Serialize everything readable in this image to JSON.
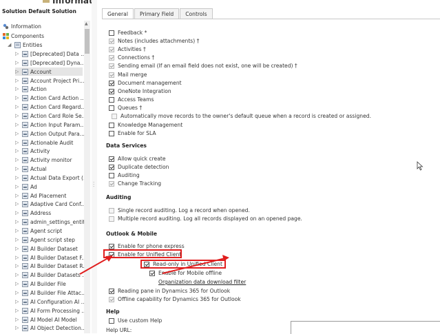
{
  "window": {
    "title": "Information"
  },
  "tree": {
    "solution": "Solution Default Solution",
    "top": [
      {
        "label": "Information",
        "icon": "info-icon"
      },
      {
        "label": "Components",
        "icon": "components-icon"
      },
      {
        "label": "Entities",
        "icon": "entities-icon"
      }
    ],
    "entities": [
      "[Deprecated] Data ...",
      "[Deprecated] Dyna...",
      "Account",
      "Account Project Pri...",
      "Action",
      "Action Card Action ...",
      "Action Card Regard...",
      "Action Card Role Se...",
      "Action Input Param...",
      "Action Output Para...",
      "Actionable Audit",
      "Activity",
      "Activity monitor",
      "Actual",
      "Actual Data Export (...",
      "Ad",
      "Ad Placement",
      "Adaptive Card Conf...",
      "Address",
      "admin_settings_entity",
      "Agent script",
      "Agent script step",
      "AI Builder Dataset",
      "AI Builder Dataset F...",
      "AI Builder Dataset R...",
      "AI Builder Datasets ...",
      "AI Builder File",
      "AI Builder File Attac...",
      "AI Configuration AI ...",
      "AI Form Processing ...",
      "AI Model AI Model",
      "AI Object Detection..."
    ],
    "selected": "Account"
  },
  "tabs": [
    "General",
    "Primary Field",
    "Controls"
  ],
  "general": {
    "communication": [
      {
        "label": "Feedback *",
        "checked": false,
        "disabled": false
      },
      {
        "label": "Notes (includes attachments) †",
        "checked": true,
        "disabled": true
      },
      {
        "label": "Activities †",
        "checked": true,
        "disabled": true
      },
      {
        "label": "Connections †",
        "checked": true,
        "disabled": true
      },
      {
        "label": "Sending email (If an email field does not exist, one will be created) †",
        "checked": true,
        "disabled": true
      },
      {
        "label": "Mail merge",
        "checked": true,
        "disabled": true
      },
      {
        "label": "Document management",
        "checked": true,
        "disabled": false
      },
      {
        "label": "OneNote Integration",
        "checked": true,
        "disabled": false
      },
      {
        "label": "Access Teams",
        "checked": false,
        "disabled": false
      },
      {
        "label": "Queues †",
        "checked": false,
        "disabled": false
      }
    ],
    "queues_sub": {
      "label": "Automatically move records to the owner's default queue when a record is created or assigned.",
      "checked": false,
      "disabled": true
    },
    "knowledge": {
      "label": "Knowledge Management",
      "checked": false
    },
    "sla": {
      "label": "Enable for SLA",
      "checked": false
    },
    "data_services": {
      "title": "Data Services",
      "items": [
        {
          "label": "Allow quick create",
          "checked": true,
          "disabled": false
        },
        {
          "label": "Duplicate detection",
          "checked": true,
          "disabled": false
        },
        {
          "label": "Auditing",
          "checked": false,
          "disabled": false
        },
        {
          "label": "Change Tracking",
          "checked": true,
          "disabled": true
        }
      ]
    },
    "auditing": {
      "title": "Auditing",
      "items": [
        {
          "label": "Single record auditing. Log a record when opened.",
          "checked": false,
          "disabled": true
        },
        {
          "label": "Multiple record auditing. Log all records displayed on an opened page.",
          "checked": false,
          "disabled": true
        }
      ]
    },
    "outlook": {
      "title": "Outlook & Mobile",
      "phone_express": {
        "label": "Enable for phone express",
        "checked": true
      },
      "unified_client": {
        "label": "Enable for Unified Client",
        "checked": true
      },
      "read_only": {
        "label": "Read-only in Unified Client",
        "checked": true
      },
      "mobile_offline": {
        "label": "Enable for Mobile offline",
        "checked": true
      },
      "org_filter": "Organization data download filter",
      "reading_pane": {
        "label": "Reading pane in Dynamics 365 for Outlook",
        "checked": true
      },
      "offline_capability": {
        "label": "Offline capability for Dynamics 365 for Outlook",
        "checked": true,
        "disabled": true
      }
    },
    "help": {
      "title": "Help",
      "custom_help": {
        "label": "Use custom Help",
        "checked": false
      },
      "url_label": "Help URL:"
    }
  },
  "annotation_color": "#e01e1e"
}
